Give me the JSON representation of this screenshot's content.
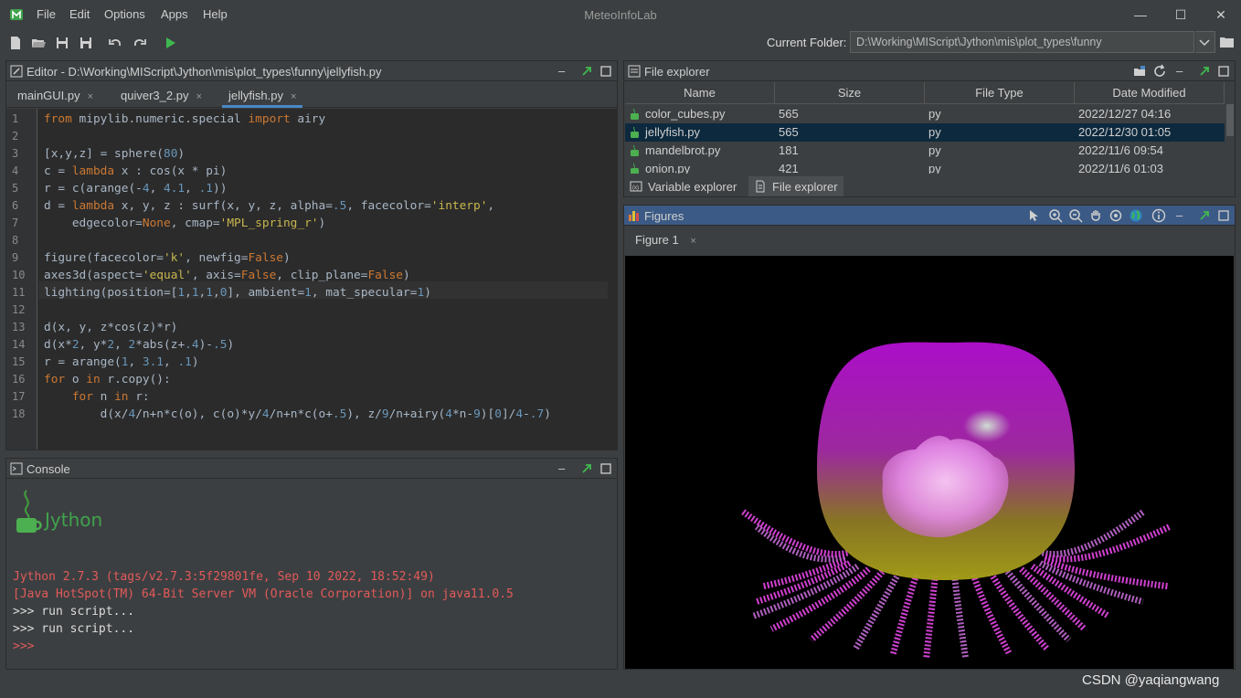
{
  "window": {
    "title": "MeteoInfoLab",
    "menu": [
      "File",
      "Edit",
      "Options",
      "Apps",
      "Help"
    ],
    "controls": [
      "minimize-icon",
      "maximize-icon",
      "close-icon"
    ]
  },
  "toolbar": {
    "current_folder_label": "Current Folder:",
    "current_folder_value": "D:\\Working\\MIScript\\Jython\\mis\\plot_types\\funny"
  },
  "editor": {
    "title": "Editor - D:\\Working\\MIScript\\Jython\\mis\\plot_types\\funny\\jellyfish.py",
    "tabs": [
      {
        "label": "mainGUI.py",
        "close": "×"
      },
      {
        "label": "quiver3_2.py",
        "close": "×"
      },
      {
        "label": "jellyfish.py",
        "close": "×"
      }
    ],
    "active_tab": "jellyfish.py",
    "line_numbers": [
      "1",
      "2",
      "3",
      "4",
      "5",
      "6",
      "7",
      "8",
      "9",
      "10",
      "11",
      "12",
      "13",
      "14",
      "15",
      "16",
      "17",
      "18"
    ],
    "code": [
      "from mipylib.numeric.special import airy",
      "",
      "[x,y,z] = sphere(80)",
      "c = lambda x : cos(x * pi)",
      "r = c(arange(-4, 4.1, .1))",
      "d = lambda x, y, z : surf(x, y, z, alpha=.5, facecolor='interp',",
      "    edgecolor=None, cmap='MPL_spring_r')",
      "",
      "figure(facecolor='k', newfig=False)",
      "axes3d(aspect='equal', axis=False, clip_plane=False)",
      "lighting(position=[1,1,1,0], ambient=1, mat_specular=1)",
      "",
      "d(x, y, z*cos(z)*r)",
      "d(x*2, y*2, 2*abs(z+.4)-.5)",
      "r = arange(1, 3.1, .1)",
      "for o in r.copy():",
      "    for n in r:",
      "        d(x/4/n+n*c(o), c(o)*y/4/n+n*c(o+.5), z/9/n+airy(4*n-9)[0]/4-.7)"
    ]
  },
  "console": {
    "title": "Console",
    "logo_text": "Jython",
    "lines": [
      {
        "text": "Jython 2.7.3 (tags/v2.7.3:5f29801fe, Sep 10 2022, 18:52:49)",
        "style": "red"
      },
      {
        "text": "[Java HotSpot(TM) 64-Bit Server VM (Oracle Corporation)] on java11.0.5",
        "style": "red"
      },
      {
        "text": ">>> run script...",
        "style": "white"
      },
      {
        "text": ">>> run script...",
        "style": "white"
      },
      {
        "text": ">>>",
        "style": "red"
      }
    ]
  },
  "file_explorer": {
    "title": "File explorer",
    "columns": [
      "Name",
      "Size",
      "File Type",
      "Date Modified"
    ],
    "rows": [
      {
        "name": "color_cubes.py",
        "size": "565",
        "type": "py",
        "date": "2022/12/27 04:16",
        "selected": false
      },
      {
        "name": "jellyfish.py",
        "size": "565",
        "type": "py",
        "date": "2022/12/30 01:05",
        "selected": true
      },
      {
        "name": "mandelbrot.py",
        "size": "181",
        "type": "py",
        "date": "2022/11/6 09:54",
        "selected": false
      },
      {
        "name": "onion.py",
        "size": "421",
        "type": "py",
        "date": "2022/11/6 01:03",
        "selected": false
      }
    ],
    "bottom_tabs": [
      {
        "label": "Variable explorer",
        "active": false
      },
      {
        "label": "File explorer",
        "active": true
      }
    ]
  },
  "figures": {
    "title": "Figures",
    "tabs": [
      {
        "label": "Figure 1",
        "close": "×"
      }
    ],
    "background": "#000000",
    "tentacle_count": 20,
    "bell_colors": [
      "#b010c8",
      "#9a8a18"
    ]
  },
  "watermark": "CSDN @yaqiangwang",
  "colors": {
    "accent": "#4a88c7",
    "selected_row": "#0d293e",
    "figures_header": "#3b5a85",
    "console_red": "#e25a5a"
  }
}
